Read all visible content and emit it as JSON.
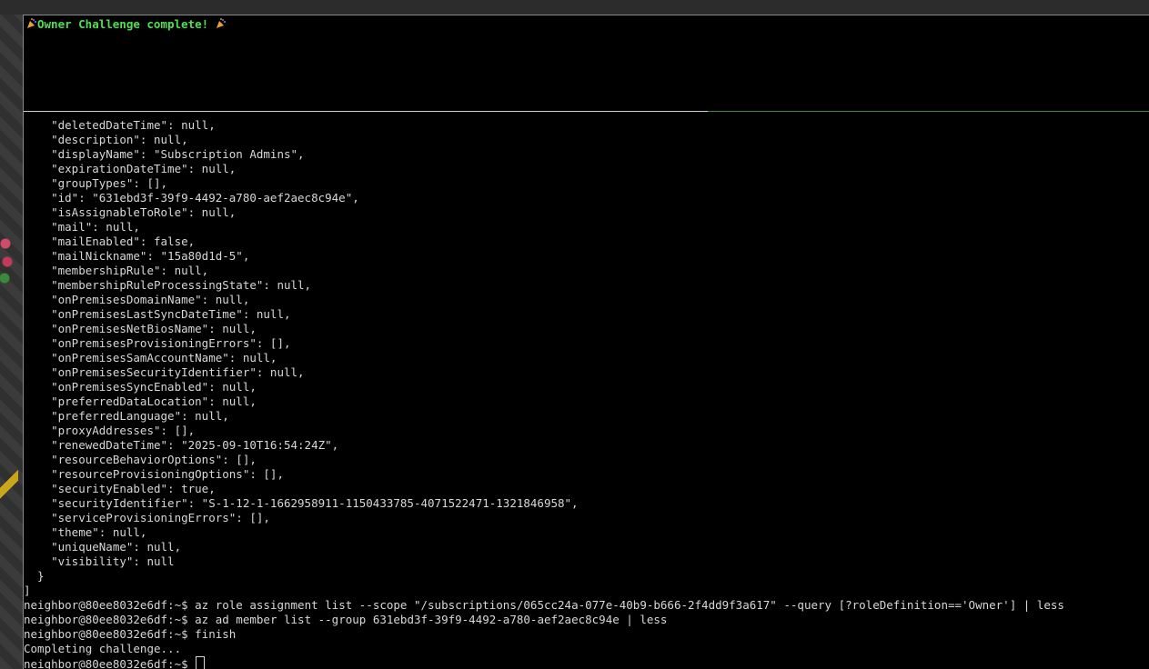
{
  "banner": {
    "icon_left": "party-popper-icon",
    "text": "Owner Challenge complete! ",
    "icon_right": "party-popper-icon"
  },
  "json_lines": [
    "    \"deletedDateTime\": null,",
    "    \"description\": null,",
    "    \"displayName\": \"Subscription Admins\",",
    "    \"expirationDateTime\": null,",
    "    \"groupTypes\": [],",
    "    \"id\": \"631ebd3f-39f9-4492-a780-aef2aec8c94e\",",
    "    \"isAssignableToRole\": null,",
    "    \"mail\": null,",
    "    \"mailEnabled\": false,",
    "    \"mailNickname\": \"15a80d1d-5\",",
    "    \"membershipRule\": null,",
    "    \"membershipRuleProcessingState\": null,",
    "    \"onPremisesDomainName\": null,",
    "    \"onPremisesLastSyncDateTime\": null,",
    "    \"onPremisesNetBiosName\": null,",
    "    \"onPremisesProvisioningErrors\": [],",
    "    \"onPremisesSamAccountName\": null,",
    "    \"onPremisesSecurityIdentifier\": null,",
    "    \"onPremisesSyncEnabled\": null,",
    "    \"preferredDataLocation\": null,",
    "    \"preferredLanguage\": null,",
    "    \"proxyAddresses\": [],",
    "    \"renewedDateTime\": \"2025-09-10T16:54:24Z\",",
    "    \"resourceBehaviorOptions\": [],",
    "    \"resourceProvisioningOptions\": [],",
    "    \"securityEnabled\": true,",
    "    \"securityIdentifier\": \"S-1-12-1-1662958911-1150433785-4071522471-1321846958\",",
    "    \"serviceProvisioningErrors\": [],",
    "    \"theme\": null,",
    "    \"uniqueName\": null,",
    "    \"visibility\": null",
    "  }",
    "]"
  ],
  "shell": {
    "prompt": "neighbor@80ee8032e6df:~$ ",
    "commands": [
      "az role assignment list --scope \"/subscriptions/065cc24a-077e-40b9-b666-2f4dd9f3a617\" --query [?roleDefinition=='Owner'] | less",
      "az ad member list --group 631ebd3f-39f9-4492-a780-aef2aec8c94e | less",
      "finish"
    ],
    "status_message": "Completing challenge...",
    "current_input": ""
  },
  "colors": {
    "banner_text": "#4fe04f",
    "terminal_text": "#d8d8d8",
    "background": "#000000"
  }
}
